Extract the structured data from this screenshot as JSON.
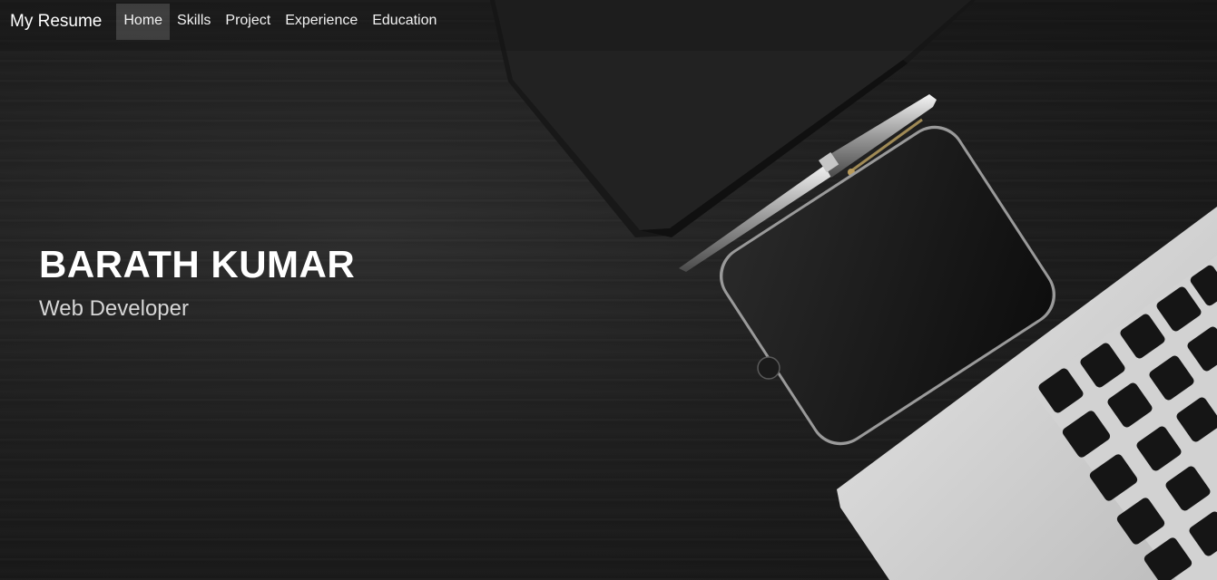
{
  "navbar": {
    "brand": "My Resume",
    "links": [
      {
        "label": "Home",
        "active": true
      },
      {
        "label": "Skills",
        "active": false
      },
      {
        "label": "Project",
        "active": false
      },
      {
        "label": "Experience",
        "active": false
      },
      {
        "label": "Education",
        "active": false
      }
    ]
  },
  "hero": {
    "name": "BARATH KUMAR",
    "title": "Web Developer"
  },
  "colors": {
    "background": "#1c1c1c",
    "text": "#ffffff",
    "nav_active": "#3a3a3a"
  },
  "icons": {
    "background_objects": [
      "notebook-image",
      "pen-image",
      "smartphone-image",
      "laptop-image"
    ]
  }
}
